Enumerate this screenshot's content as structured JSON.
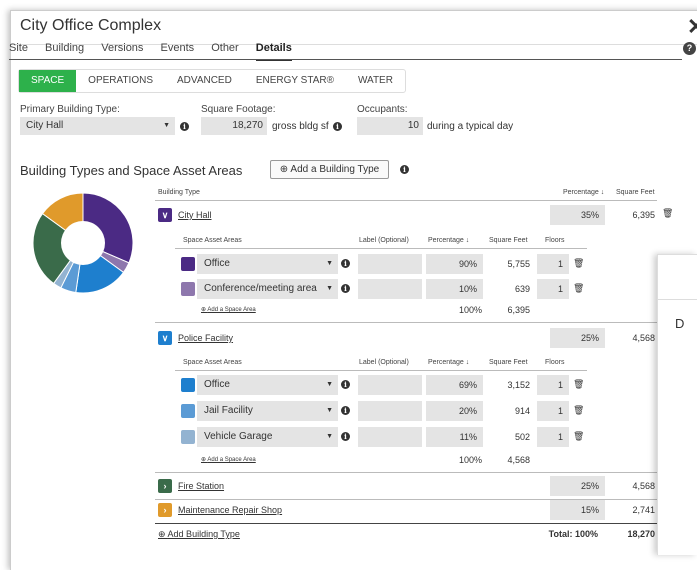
{
  "window": {
    "title": "City Office Complex",
    "close": "✕"
  },
  "tabs": [
    "Site",
    "Building",
    "Versions",
    "Events",
    "Other",
    "Details"
  ],
  "subtabs": [
    "SPACE",
    "OPERATIONS",
    "ADVANCED",
    "ENERGY STAR®",
    "WATER"
  ],
  "form": {
    "primary_type_label": "Primary Building Type:",
    "primary_type_value": "City Hall",
    "sqft_label": "Square Footage:",
    "sqft_value": "18,270",
    "sqft_unit": "gross bldg sf",
    "occ_label": "Occupants:",
    "occ_value": "10",
    "occ_suffix": "during a typical day"
  },
  "section": {
    "title": "Building Types and Space Asset Areas",
    "add_button": "Add a Building Type"
  },
  "headers": {
    "building_type": "Building Type",
    "percentage": "Percentage ↓",
    "square_feet": "Square Feet",
    "space_asset_areas": "Space Asset Areas",
    "label_optional": "Label (Optional)",
    "floors": "Floors"
  },
  "buildings": [
    {
      "name": "City Hall",
      "pct": "35%",
      "sqft": "6,395",
      "color": "#4b2a84",
      "chev": "v",
      "areas": [
        {
          "name": "Office",
          "pct": "90%",
          "sqft": "5,755",
          "floors": "1",
          "color": "#4b2a84"
        },
        {
          "name": "Conference/meeting area",
          "pct": "10%",
          "sqft": "639",
          "floors": "1",
          "color": "#8e77ad"
        }
      ],
      "total_pct": "100%",
      "total_sqft": "6,395"
    },
    {
      "name": "Police Facility",
      "pct": "25%",
      "sqft": "4,568",
      "color": "#1e7fce",
      "chev": "v",
      "areas": [
        {
          "name": "Office",
          "pct": "69%",
          "sqft": "3,152",
          "floors": "1",
          "color": "#1e7fce"
        },
        {
          "name": "Jail Facility",
          "pct": "20%",
          "sqft": "914",
          "floors": "1",
          "color": "#5b9bd5"
        },
        {
          "name": "Vehicle Garage",
          "pct": "11%",
          "sqft": "502",
          "floors": "1",
          "color": "#93b3d1"
        }
      ],
      "total_pct": "100%",
      "total_sqft": "4,568"
    },
    {
      "name": "Fire Station",
      "pct": "25%",
      "sqft": "4,568",
      "color": "#3a6b4a",
      "chev": ">"
    },
    {
      "name": "Maintenance Repair Shop",
      "pct": "15%",
      "sqft": "2,741",
      "color": "#e09a2b",
      "chev": ">"
    }
  ],
  "add_space_area": "Add a Space Area",
  "add_building_type": "Add Building Type",
  "total": {
    "label": "Total: 100%",
    "sqft": "18,270"
  },
  "side_panel": {
    "letter": "D"
  },
  "donut": {
    "segments": [
      {
        "value": 31.5,
        "color": "#4b2a84"
      },
      {
        "value": 3.5,
        "color": "#8e77ad"
      },
      {
        "value": 17.3,
        "color": "#1e7fce"
      },
      {
        "value": 5,
        "color": "#5b9bd5"
      },
      {
        "value": 2.7,
        "color": "#93b3d1"
      },
      {
        "value": 25,
        "color": "#3a6b4a"
      },
      {
        "value": 15,
        "color": "#e09a2b"
      }
    ]
  }
}
